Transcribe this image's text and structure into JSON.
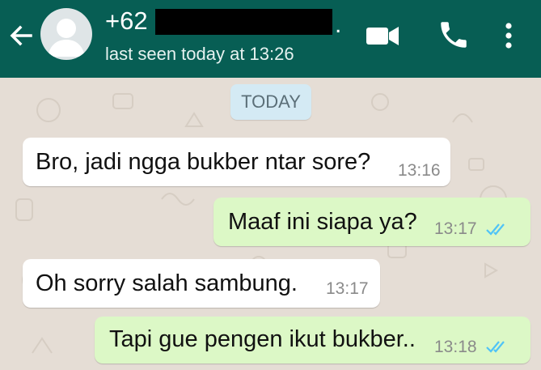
{
  "header": {
    "back_icon": "arrow-left-icon",
    "avatar_icon": "default-avatar-icon",
    "contact_name": "+62",
    "contact_suffix": ".",
    "status": "last seen today at 13:26",
    "actions": [
      "video-call-icon",
      "phone-icon",
      "more-vert-icon"
    ]
  },
  "date_chip": "TODAY",
  "messages": [
    {
      "direction": "incoming",
      "text": "Bro, jadi ngga bukber ntar sore?",
      "time": "13:16"
    },
    {
      "direction": "outgoing",
      "text": "Maaf ini siapa ya?",
      "time": "13:17",
      "status": "read"
    },
    {
      "direction": "incoming",
      "text": "Oh sorry salah sambung.",
      "time": "13:17"
    },
    {
      "direction": "outgoing",
      "text": "Tapi gue pengen ikut bukber..",
      "time": "13:18",
      "status": "read"
    }
  ],
  "colors": {
    "header": "#075e54",
    "chat_background": "#e5ddd5",
    "incoming_bubble": "#ffffff",
    "outgoing_bubble": "#dcf8c6",
    "read_ticks": "#4fc3f7",
    "date_chip": "#d4eaf4"
  }
}
